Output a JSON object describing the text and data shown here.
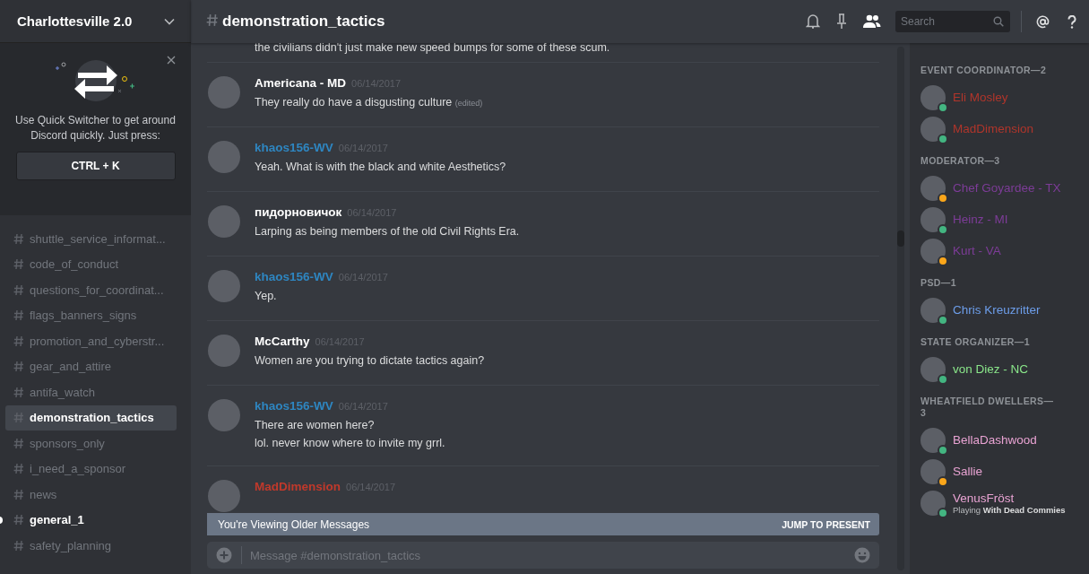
{
  "server": {
    "name": "Charlottesville 2.0"
  },
  "quick_switcher": {
    "text": "Use Quick Switcher to get around Discord quickly. Just press:",
    "shortcut": "CTRL + K"
  },
  "channels": [
    {
      "name": "shuttle_service_informat...",
      "selected": false,
      "unread": false
    },
    {
      "name": "code_of_conduct",
      "selected": false,
      "unread": false
    },
    {
      "name": "questions_for_coordinat...",
      "selected": false,
      "unread": false
    },
    {
      "name": "flags_banners_signs",
      "selected": false,
      "unread": false
    },
    {
      "name": "promotion_and_cyberstr...",
      "selected": false,
      "unread": false
    },
    {
      "name": "gear_and_attire",
      "selected": false,
      "unread": false
    },
    {
      "name": "antifa_watch",
      "selected": false,
      "unread": false
    },
    {
      "name": "demonstration_tactics",
      "selected": true,
      "unread": false
    },
    {
      "name": "sponsors_only",
      "selected": false,
      "unread": false
    },
    {
      "name": "i_need_a_sponsor",
      "selected": false,
      "unread": false
    },
    {
      "name": "news",
      "selected": false,
      "unread": false
    },
    {
      "name": "general_1",
      "selected": false,
      "unread": true
    },
    {
      "name": "safety_planning",
      "selected": false,
      "unread": false
    }
  ],
  "header": {
    "channel": "demonstration_tactics",
    "search_placeholder": "Search"
  },
  "messages": [
    {
      "kind": "continuation",
      "lines": [
        "the civilians didn't just make new speed bumps for some of these scum."
      ]
    },
    {
      "kind": "group",
      "author": "Americana - MD",
      "color": "#ffffff",
      "timestamp": "06/14/2017",
      "lines": [
        "They really do have a disgusting culture"
      ],
      "edited_label": "(edited)"
    },
    {
      "kind": "group",
      "author": "khaos156-WV",
      "color": "#2e86c1",
      "timestamp": "06/14/2017",
      "lines": [
        "Yeah. What is with the black and white Aesthetics?"
      ]
    },
    {
      "kind": "group",
      "author": "пидорновичок",
      "color": "#ffffff",
      "timestamp": "06/14/2017",
      "lines": [
        "Larping as being members of the old Civil Rights Era."
      ]
    },
    {
      "kind": "group",
      "author": "khaos156-WV",
      "color": "#2e86c1",
      "timestamp": "06/14/2017",
      "lines": [
        "Yep."
      ]
    },
    {
      "kind": "group",
      "author": "McCarthy",
      "color": "#ffffff",
      "timestamp": "06/14/2017",
      "lines": [
        "Women are you trying to dictate tactics again?"
      ]
    },
    {
      "kind": "group",
      "author": "khaos156-WV",
      "color": "#2e86c1",
      "timestamp": "06/14/2017",
      "lines": [
        "There are women here?",
        "lol. never know where to invite my grrl."
      ]
    },
    {
      "kind": "group",
      "author": "MadDimension",
      "color": "#c0392b",
      "timestamp": "06/14/2017"
    }
  ],
  "banner": {
    "text": "You're Viewing Older Messages",
    "action": "JUMP TO PRESENT"
  },
  "composer": {
    "placeholder": "Message #demonstration_tactics"
  },
  "member_groups": [
    {
      "title": "EVENT COORDINATOR—2",
      "color": "#b0352b",
      "members": [
        {
          "name": "Eli Mosley",
          "color": "#43b581"
        },
        {
          "name": "MadDimension",
          "color": "#43b581"
        }
      ]
    },
    {
      "title": "MODERATOR—3",
      "color": "#7d3c98",
      "members": [
        {
          "name": "Chef Goyardee - TX",
          "color": "#faa61a"
        },
        {
          "name": "Heinz - MI",
          "color": "#43b581"
        },
        {
          "name": "Kurt - VA",
          "color": "#faa61a"
        }
      ]
    },
    {
      "title": "PSD—1",
      "color": "#6d9eeb",
      "members": [
        {
          "name": "Chris Kreuzritter",
          "color": "#43b581"
        }
      ]
    },
    {
      "title": "STATE ORGANIZER—1",
      "color": "#8ae68a",
      "members": [
        {
          "name": "von Diez - NC",
          "color": "#43b581"
        }
      ]
    },
    {
      "title": "WHEATFIELD DWELLERS—3",
      "color": "#e9a3d3",
      "members": [
        {
          "name": "BellaDashwood",
          "color": "#43b581"
        },
        {
          "name": "Sallie",
          "color": "#faa61a"
        },
        {
          "name": "VenusFröst",
          "color": "#43b581",
          "activity": "Playing **With Dead Commies**"
        }
      ]
    }
  ]
}
